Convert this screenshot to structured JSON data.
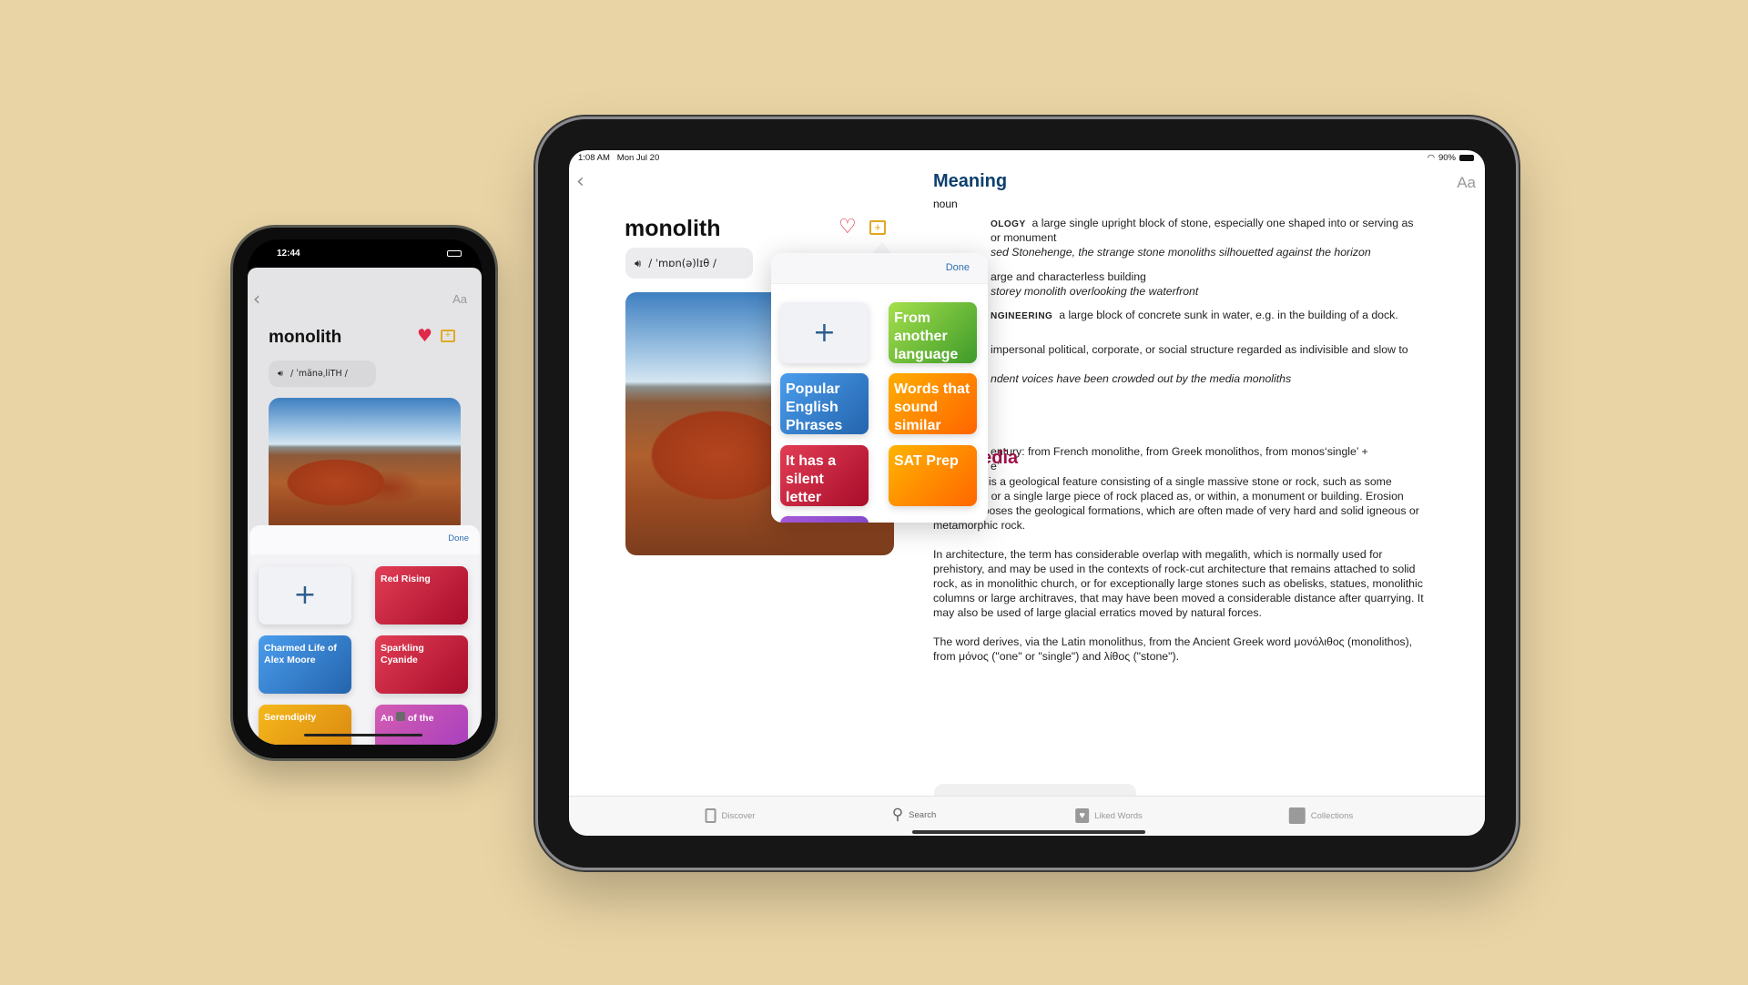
{
  "ipad": {
    "status": {
      "time": "1:08 AM",
      "date": "Mon Jul 20",
      "battery": "90%"
    },
    "nav": {
      "back_icon": "chevron-left",
      "text_size_label": "Aa"
    },
    "word": "monolith",
    "pronunciation": "/ ˈmɒn(ə)lɪθ /",
    "popover": {
      "done_label": "Done",
      "add_icon": "plus",
      "collections": [
        {
          "label": "From another language",
          "color": "#5cb833"
        },
        {
          "label": "Popular English Phrases",
          "color": "#3b84d6"
        },
        {
          "label": "Words that sound similar",
          "color": "#ff8a00"
        },
        {
          "label": "It has a silent letter",
          "color": "#cc2540"
        },
        {
          "label": "SAT Prep",
          "color": "#ff9000"
        }
      ]
    },
    "meaning": {
      "title": "Meaning",
      "pos": "noun",
      "lines": [
        {
          "label": "OLOGY",
          "text": "a large single upright block of stone, especially one shaped into or serving as"
        },
        {
          "text": "or monument"
        },
        {
          "example": "sed Stonehenge, the strange stone monoliths silhouetted against the horizon"
        },
        {
          "text": "arge and characterless building"
        },
        {
          "example": "storey monolith overlooking the waterfront"
        },
        {
          "label": "NGINEERING",
          "text": "a large block of concrete sunk in water, e.g. in the building of a dock."
        },
        {
          "text": "impersonal political, corporate, or social structure regarded as indivisible and slow to"
        },
        {
          "example": "ndent voices have been crowded out by the media monoliths"
        },
        {
          "text": "entury: from French monolithe, from Greek monolithos, from monos‘single’ +"
        },
        {
          "text": "e’"
        }
      ]
    },
    "wikipedia": {
      "title": "Wikipedia",
      "paragraphs": [
        "A monolith is a geological feature consisting of a single massive stone or rock, such as some mountains, or a single large piece of rock placed as, or within, a monument or building. Erosion usually exposes the geological formations, which are often made of very hard and solid igneous or metamorphic rock.",
        "In architecture, the term has considerable overlap with megalith, which is normally used for prehistory, and may be used in the contexts of rock-cut architecture that remains attached to solid rock, as in monolithic church, or for exceptionally large stones such as obelisks, statues, monolithic columns or large architraves, that may have been moved a considerable distance after quarrying. It may also be used of large glacial erratics moved by natural forces.",
        "The word derives, via the Latin monolithus, from the Ancient Greek word μονόλιθος (monolithos), from μόνος (\"one\" or \"single\") and λίθος (\"stone\")."
      ]
    },
    "tabs": [
      {
        "label": "Discover",
        "icon": "book"
      },
      {
        "label": "Search",
        "icon": "magnifier"
      },
      {
        "label": "Liked Words",
        "icon": "heart"
      },
      {
        "label": "Collections",
        "icon": "stack"
      }
    ],
    "colors": {
      "meaning": "#0c3f6e",
      "wikipedia": "#a3104a",
      "heart": "#d81e3c",
      "folder": "#e0a825"
    }
  },
  "phone": {
    "status": {
      "time": "12:44"
    },
    "nav": {
      "text_size_label": "Aa"
    },
    "word": "monolith",
    "pronunciation": "/ ˈmänəˌliTH /",
    "sheet": {
      "done_label": "Done",
      "collections": [
        {
          "label": "Red Rising",
          "color": "#cc2540"
        },
        {
          "label": "Charmed Life of Alex Moore",
          "color": "#3b84d6"
        },
        {
          "label": "Sparkling Cyanide",
          "color": "#cc2540"
        },
        {
          "label": "Serendipity",
          "color": "#e8a012"
        },
        {
          "label_start": "An",
          "label_end": "of the",
          "color": "#c24fb5"
        }
      ]
    }
  }
}
